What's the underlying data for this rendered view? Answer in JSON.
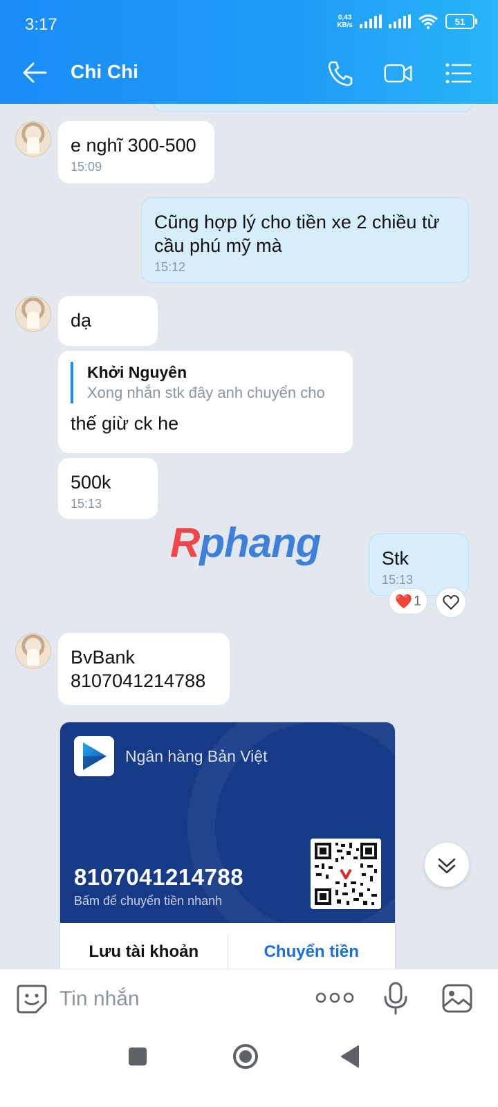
{
  "status_bar": {
    "time": "3:17",
    "net_speed_value": "0,43",
    "net_speed_unit": "KB/s",
    "battery": "51"
  },
  "header": {
    "contact_name": "Chi Chi"
  },
  "messages": [
    {
      "side": "in",
      "text": "e nghĩ 300-500",
      "time": "15:09"
    },
    {
      "side": "out",
      "text": "Cũng hợp lý cho tiền xe 2 chiều từ cầu phú mỹ mà",
      "time": "15:12"
    },
    {
      "side": "in",
      "text": "dạ"
    },
    {
      "side": "in",
      "reply_to": {
        "author": "Khởi Nguyên",
        "text": "Xong nhắn stk đây anh chuyển cho"
      },
      "text": "thế giừ ck he"
    },
    {
      "side": "in",
      "text": "500k",
      "time": "15:13"
    },
    {
      "side": "out",
      "text": "Stk",
      "time": "15:13",
      "reaction": {
        "emoji": "❤️",
        "count": "1"
      }
    },
    {
      "side": "in",
      "text_lines": [
        "BvBank",
        "8107041214788"
      ]
    }
  ],
  "watermark": {
    "first": "R",
    "rest": "phang"
  },
  "bank_card": {
    "bank_name": "Ngân hàng Bản Việt",
    "account_number": "8107041214788",
    "hint": "Bấm để chuyển tiền nhanh",
    "save_label": "Lưu tài khoản",
    "transfer_label": "Chuyển tiền"
  },
  "composer": {
    "placeholder": "Tin nhắn"
  },
  "colors": {
    "header": "#1a8cf7",
    "outgoing_bubble": "#d6edfc",
    "bank_card": "#173a86",
    "link": "#1a6fd1"
  },
  "icons": [
    "back-arrow-icon",
    "phone-icon",
    "video-call-icon",
    "menu-icon",
    "heart-icon",
    "chevron-double-down-icon",
    "sticker-icon",
    "more-dots-icon",
    "microphone-icon",
    "gallery-icon"
  ]
}
